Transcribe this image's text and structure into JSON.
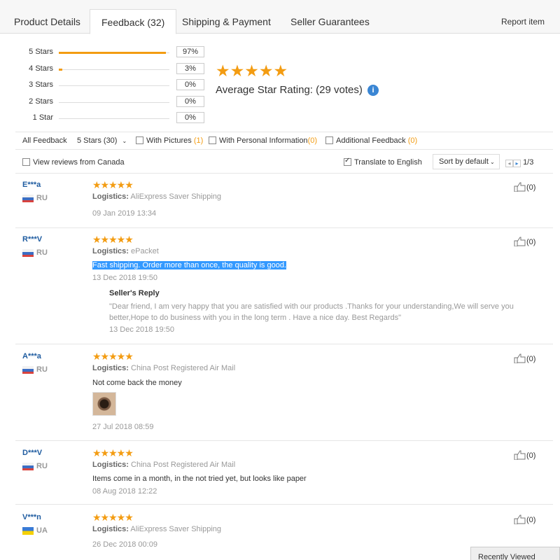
{
  "tabs": [
    {
      "label": "Product Details"
    },
    {
      "label": "Feedback (32)"
    },
    {
      "label": "Shipping & Payment"
    },
    {
      "label": "Seller Guarantees"
    }
  ],
  "report_item": "Report item",
  "rating_breakdown": [
    {
      "label": "5 Stars",
      "percent": "97%",
      "fraction": 0.97
    },
    {
      "label": "4 Stars",
      "percent": "3%",
      "fraction": 0.03
    },
    {
      "label": "3 Stars",
      "percent": "0%",
      "fraction": 0
    },
    {
      "label": "2 Stars",
      "percent": "0%",
      "fraction": 0
    },
    {
      "label": "1 Star",
      "percent": "0%",
      "fraction": 0
    }
  ],
  "summary": {
    "stars": "★★★★★",
    "average_label": "Average Star Rating:",
    "votes": "(29 votes)",
    "info_icon": "i"
  },
  "filters": {
    "all_feedback": "All Feedback",
    "stars_select": "5 Stars (30)",
    "with_pictures": "With Pictures",
    "with_pictures_count": "(1)",
    "personal_info": "With Personal Information",
    "personal_info_count": "(0)",
    "additional": "Additional Feedback",
    "additional_count": "(0)",
    "canada": "View reviews from Canada",
    "translate": "Translate to English",
    "sort": "Sort by default",
    "page": "1/3"
  },
  "reviews": [
    {
      "user": "E***a",
      "country": "RU",
      "stars": "★★★★★",
      "logistics_label": "Logistics:",
      "logistics": "AliExpress Saver Shipping",
      "text": "",
      "date": "09 Jan 2019 13:34",
      "likes": "(0)"
    },
    {
      "user": "R***V",
      "country": "RU",
      "stars": "★★★★★",
      "logistics_label": "Logistics:",
      "logistics": "ePacket",
      "text": "Fast shipping. Order more than once, the quality is good.",
      "date": "13 Dec 2018 19:50",
      "likes": "(0)",
      "seller_reply": {
        "heading": "Seller's Reply",
        "text": "\"Dear friend, I am very happy that you are satisfied with our products .Thanks for your understanding,We will serve you better,Hope to do business with you in the long term . Have a nice day. Best Regards\"",
        "date": "13 Dec 2018 19:50"
      }
    },
    {
      "user": "A***a",
      "country": "RU",
      "stars": "★★★★★",
      "logistics_label": "Logistics:",
      "logistics": "China Post Registered Air Mail",
      "text": "Not come back the money",
      "date": "27 Jul 2018 08:59",
      "likes": "(0)"
    },
    {
      "user": "D***V",
      "country": "RU",
      "stars": "★★★★★",
      "logistics_label": "Logistics:",
      "logistics": "China Post Registered Air Mail",
      "text": "Items come in a month, in the not tried yet, but looks like paper",
      "date": "08 Aug 2018 12:22",
      "likes": "(0)"
    },
    {
      "user": "V***n",
      "country": "UA",
      "stars": "★★★★★",
      "logistics_label": "Logistics:",
      "logistics": "AliExpress Saver Shipping",
      "text": "",
      "date": "26 Dec 2018 00:09",
      "likes": "(0)"
    }
  ],
  "recently_viewed": "Recently Viewed",
  "colors": {
    "accent": "#f39c12",
    "link": "#1f5ca0",
    "highlight": "#3399ff"
  }
}
